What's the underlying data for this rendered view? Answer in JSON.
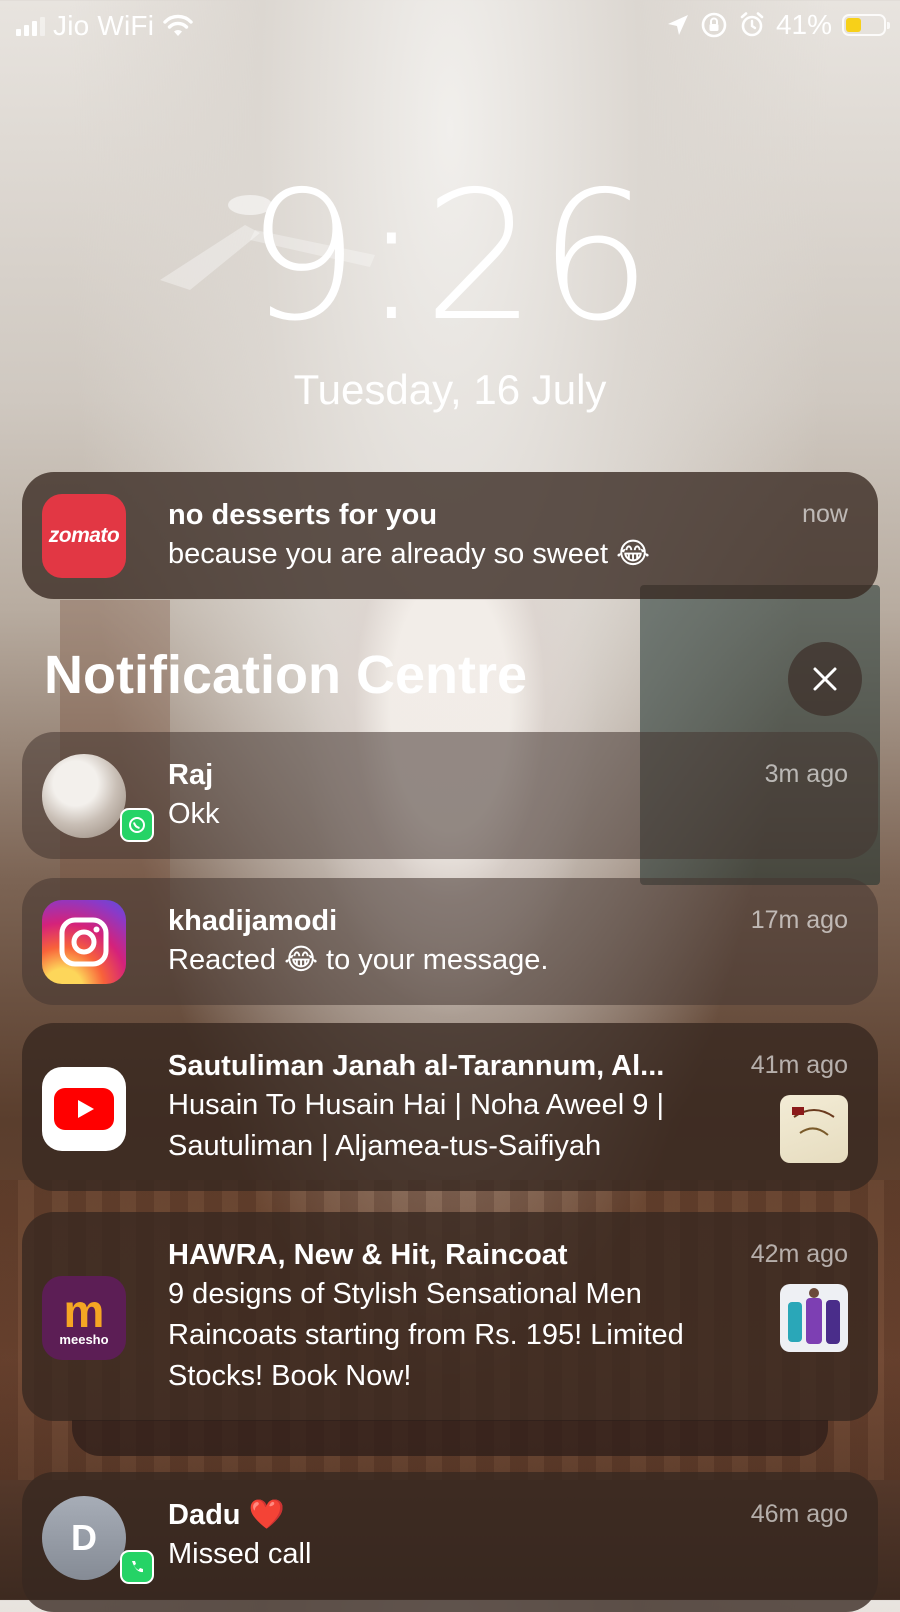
{
  "status_bar": {
    "carrier": "Jio WiFi",
    "battery_percent": "41%",
    "battery_level": 0.41,
    "battery_color": "#f7d019",
    "icons": [
      "signal-icon",
      "wifi-icon",
      "location-icon",
      "orientation-lock-icon",
      "alarm-icon",
      "battery-icon"
    ]
  },
  "lock": {
    "time": "9:26",
    "date": "Tuesday, 16 July"
  },
  "top_notification": {
    "app": "zomato",
    "icon_text": "zomato",
    "title": "no desserts for you",
    "body": "because you are already so sweet 😂",
    "time": "now"
  },
  "notification_centre": {
    "title": "Notification Centre",
    "close_icon": "close-icon",
    "items": [
      {
        "app": "whatsapp",
        "title": "Raj",
        "body": "Okk",
        "time": "3m ago"
      },
      {
        "app": "instagram",
        "title": "khadijamodi",
        "body": "Reacted 😂 to your message.",
        "time": "17m ago"
      },
      {
        "app": "youtube",
        "title": "Sautuliman Janah al-Tarannum, Al...",
        "body": "Husain To Husain Hai | Noha Aweel 9 | Sautuliman | Aljamea-tus-Saifiyah",
        "time": "41m ago"
      },
      {
        "app": "meesho",
        "icon_text": "meesho",
        "title": "HAWRA, New & Hit, Raincoat",
        "body": "9 designs of Stylish Sensational Men Raincoats starting from Rs. 195! Limited Stocks! Book Now!",
        "time": "42m ago"
      },
      {
        "app": "phone",
        "avatar_letter": "D",
        "title": "Dadu ❤️",
        "body": "Missed call",
        "time": "46m ago"
      }
    ]
  }
}
